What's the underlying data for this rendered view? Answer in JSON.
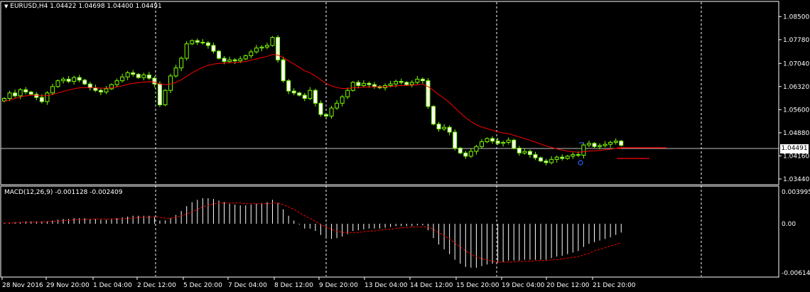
{
  "header": {
    "symbol_label": "EURUSD,H4",
    "ohlc": "1.04422 1.04698 1.04400 1.04491",
    "menu_arrow_icon": "triangle-down-icon"
  },
  "price_axis": {
    "ticks": [
      "1.08500",
      "1.07780",
      "1.07040",
      "1.06320",
      "1.05600",
      "1.04880",
      "1.04160",
      "1.03440"
    ],
    "current_price": "1.04491"
  },
  "macd": {
    "label": "MACD(12,26,9) -0.001128 -0.002409",
    "ticks": [
      "0.003995",
      "0.00",
      "-0.00614"
    ]
  },
  "time_axis": {
    "ticks": [
      "28 Nov 2016",
      "29 Nov 20:00",
      "1 Dec 04:00",
      "2 Dec 12:00",
      "5 Dec 20:00",
      "7 Dec 04:00",
      "8 Dec 12:00",
      "9 Dec 20:00",
      "13 Dec 04:00",
      "14 Dec 12:00",
      "15 Dec 20:00",
      "19 Dec 04:00",
      "20 Dec 12:00",
      "21 Dec 20:00"
    ]
  },
  "colors": {
    "background": "#000000",
    "candle": "#7CFC00",
    "candle_bull_fill": "#000000",
    "ma_line": "#FF0000",
    "signal_line": "#FF0000",
    "histogram": "#FFFFFF",
    "grid": "#FFFFFF"
  },
  "chart_data": {
    "type": "candlestick",
    "title": "EURUSD,H4",
    "ylim": [
      1.0335,
      1.0875
    ],
    "closes": [
      1.0595,
      1.0612,
      1.0603,
      1.0622,
      1.0615,
      1.0608,
      1.0598,
      1.0585,
      1.0612,
      1.0632,
      1.065,
      1.0655,
      1.0648,
      1.066,
      1.0652,
      1.064,
      1.0628,
      1.062,
      1.0615,
      1.0625,
      1.0638,
      1.065,
      1.0662,
      1.0675,
      1.067,
      1.066,
      1.0668,
      1.0658,
      1.064,
      1.0575,
      1.062,
      1.0665,
      1.069,
      1.072,
      1.0765,
      1.0775,
      1.077,
      1.0768,
      1.076,
      1.0742,
      1.072,
      1.071,
      1.0715,
      1.0712,
      1.0718,
      1.0728,
      1.074,
      1.0752,
      1.0755,
      1.076,
      1.0785,
      1.0715,
      1.065,
      1.0618,
      1.0612,
      1.0605,
      1.0595,
      1.062,
      1.058,
      1.0545,
      1.054,
      1.0565,
      1.058,
      1.06,
      1.062,
      1.0645,
      1.0635,
      1.0642,
      1.0638,
      1.0632,
      1.0628,
      1.0635,
      1.064,
      1.0648,
      1.0645,
      1.0638,
      1.0645,
      1.0655,
      1.065,
      1.057,
      1.0515,
      1.05,
      1.0505,
      1.049,
      1.044,
      1.0425,
      1.0415,
      1.043,
      1.0445,
      1.046,
      1.047,
      1.0462,
      1.0455,
      1.0458,
      1.0465,
      1.044,
      1.0425,
      1.043,
      1.042,
      1.041,
      1.04,
      1.0395,
      1.0405,
      1.0412,
      1.0408,
      1.0415,
      1.042,
      1.0418,
      1.045,
      1.0455,
      1.0445,
      1.0448,
      1.0452,
      1.0458,
      1.0462,
      1.0449
    ],
    "ma_values": [
      1.0585,
      1.059,
      1.0595,
      1.06,
      1.0603,
      1.0605,
      1.0605,
      1.0603,
      1.0604,
      1.0607,
      1.0612,
      1.0617,
      1.0621,
      1.0625,
      1.0628,
      1.0629,
      1.0629,
      1.0628,
      1.0627,
      1.0627,
      1.0628,
      1.0631,
      1.0634,
      1.0639,
      1.0642,
      1.0644,
      1.0646,
      1.0647,
      1.0646,
      1.064,
      1.0638,
      1.064,
      1.0645,
      1.0653,
      1.0664,
      1.0675,
      1.0684,
      1.0692,
      1.0698,
      1.0702,
      1.0704,
      1.0705,
      1.0706,
      1.0707,
      1.0708,
      1.071,
      1.0714,
      1.0718,
      1.0722,
      1.0726,
      1.0732,
      1.073,
      1.0722,
      1.0712,
      1.0702,
      1.0692,
      1.0681,
      1.0675,
      1.0665,
      1.0653,
      1.0642,
      1.0634,
      1.0629,
      1.0626,
      1.0626,
      1.0628,
      1.0629,
      1.063,
      1.0631,
      1.0631,
      1.0631,
      1.0631,
      1.0632,
      1.0634,
      1.0635,
      1.0635,
      1.0636,
      1.0638,
      1.0639,
      1.0632,
      1.062,
      1.0607,
      1.0595,
      1.0582,
      1.0566,
      1.055,
      1.0535,
      1.0523,
      1.0513,
      1.0506,
      1.0501,
      1.0496,
      1.0491,
      1.0487,
      1.0485,
      1.048,
      1.0475,
      1.047,
      1.0465,
      1.0459,
      1.0453,
      1.0447,
      1.0442,
      1.0438,
      1.0434,
      1.0431,
      1.0429,
      1.0427,
      1.0429,
      1.0431,
      1.0432,
      1.0433,
      1.0435,
      1.0437,
      1.0439,
      1.044
    ],
    "macd_hist": [
      0.0001,
      0.0001,
      0.0002,
      0.0002,
      0.0003,
      0.0003,
      0.0003,
      0.0003,
      0.0003,
      0.0004,
      0.0005,
      0.0006,
      0.0006,
      0.0007,
      0.0007,
      0.0007,
      0.0006,
      0.0006,
      0.0005,
      0.0005,
      0.0006,
      0.0007,
      0.0008,
      0.0009,
      0.001,
      0.001,
      0.001,
      0.001,
      0.0008,
      0.0004,
      0.0004,
      0.0007,
      0.0011,
      0.0016,
      0.0022,
      0.0027,
      0.003,
      0.0032,
      0.0032,
      0.0031,
      0.0029,
      0.0027,
      0.0025,
      0.0024,
      0.0023,
      0.0023,
      0.0024,
      0.0025,
      0.0026,
      0.0027,
      0.003,
      0.0026,
      0.0018,
      0.001,
      0.0004,
      -0.0001,
      -0.0006,
      -0.0006,
      -0.0009,
      -0.0014,
      -0.0018,
      -0.0019,
      -0.0018,
      -0.0016,
      -0.0013,
      -0.0009,
      -0.0008,
      -0.0007,
      -0.0006,
      -0.0006,
      -0.0006,
      -0.0005,
      -0.0004,
      -0.0003,
      -0.0003,
      -0.0003,
      -0.0003,
      -0.0002,
      -0.0002,
      -0.0008,
      -0.0018,
      -0.0026,
      -0.0032,
      -0.0038,
      -0.0045,
      -0.005,
      -0.0054,
      -0.0055,
      -0.0055,
      -0.0053,
      -0.0051,
      -0.005,
      -0.0049,
      -0.0048,
      -0.0046,
      -0.0046,
      -0.0046,
      -0.0045,
      -0.0045,
      -0.0045,
      -0.0045,
      -0.0045,
      -0.0043,
      -0.0041,
      -0.004,
      -0.0038,
      -0.0036,
      -0.0034,
      -0.0029,
      -0.0025,
      -0.0023,
      -0.0021,
      -0.0019,
      -0.0017,
      -0.0014,
      -0.0011
    ],
    "macd_signal": [
      0.0001,
      0.0001,
      0.0001,
      0.0002,
      0.0002,
      0.0002,
      0.0002,
      0.0002,
      0.0003,
      0.0003,
      0.0003,
      0.0004,
      0.0004,
      0.0005,
      0.0005,
      0.0005,
      0.0006,
      0.0006,
      0.0006,
      0.0006,
      0.0006,
      0.0006,
      0.0006,
      0.0007,
      0.0007,
      0.0008,
      0.0008,
      0.0008,
      0.0009,
      0.0008,
      0.0007,
      0.0007,
      0.0008,
      0.001,
      0.0012,
      0.0015,
      0.0018,
      0.0021,
      0.0023,
      0.0025,
      0.0026,
      0.0026,
      0.0026,
      0.0026,
      0.0026,
      0.0025,
      0.0025,
      0.0025,
      0.0025,
      0.0025,
      0.0026,
      0.0026,
      0.0024,
      0.0021,
      0.0018,
      0.0014,
      0.001,
      0.0007,
      0.0003,
      -0.0001,
      -0.0004,
      -0.0007,
      -0.0009,
      -0.0011,
      -0.0011,
      -0.0011,
      -0.0011,
      -0.001,
      -0.0009,
      -0.0009,
      -0.0008,
      -0.0007,
      -0.0007,
      -0.0006,
      -0.0005,
      -0.0005,
      -0.0004,
      -0.0004,
      -0.0004,
      -0.0004,
      -0.0007,
      -0.0011,
      -0.0015,
      -0.0019,
      -0.0024,
      -0.0029,
      -0.0034,
      -0.0038,
      -0.0041,
      -0.0044,
      -0.0045,
      -0.0047,
      -0.0048,
      -0.0048,
      -0.0048,
      -0.0048,
      -0.0047,
      -0.0047,
      -0.0047,
      -0.0046,
      -0.0046,
      -0.0046,
      -0.0045,
      -0.0045,
      -0.0044,
      -0.0043,
      -0.0042,
      -0.0041,
      -0.0039,
      -0.0037,
      -0.0034,
      -0.0032,
      -0.003,
      -0.0028,
      -0.0026,
      -0.0024
    ],
    "macd_ylim": [
      -0.00614,
      0.003995
    ],
    "grid": true
  }
}
